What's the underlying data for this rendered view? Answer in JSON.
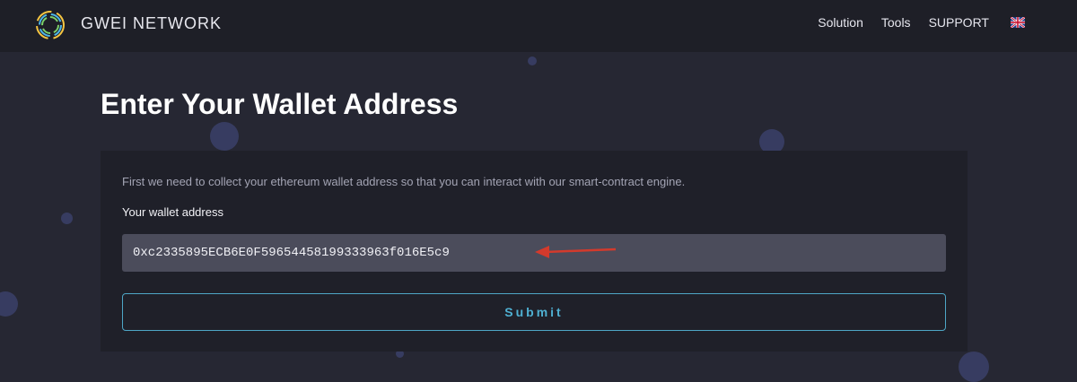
{
  "nav": {
    "brand": "GWEI NETWORK",
    "links": [
      "Solution",
      "Tools",
      "SUPPORT"
    ],
    "flag_icon": "uk-flag-icon",
    "logo_icon": "ring-logo-icon"
  },
  "page": {
    "title": "Enter Your Wallet Address"
  },
  "form": {
    "intro": "First we need to collect your ethereum wallet address so that you can interact with our smart-contract engine.",
    "label": "Your wallet address",
    "wallet_value": "0xc2335895ECB6E0F59654458199333963f016E5c9",
    "submit_label": "Submit"
  },
  "colors": {
    "accent": "#4fb0d2",
    "annotation_arrow": "#d33a2c",
    "background": "#262733"
  }
}
